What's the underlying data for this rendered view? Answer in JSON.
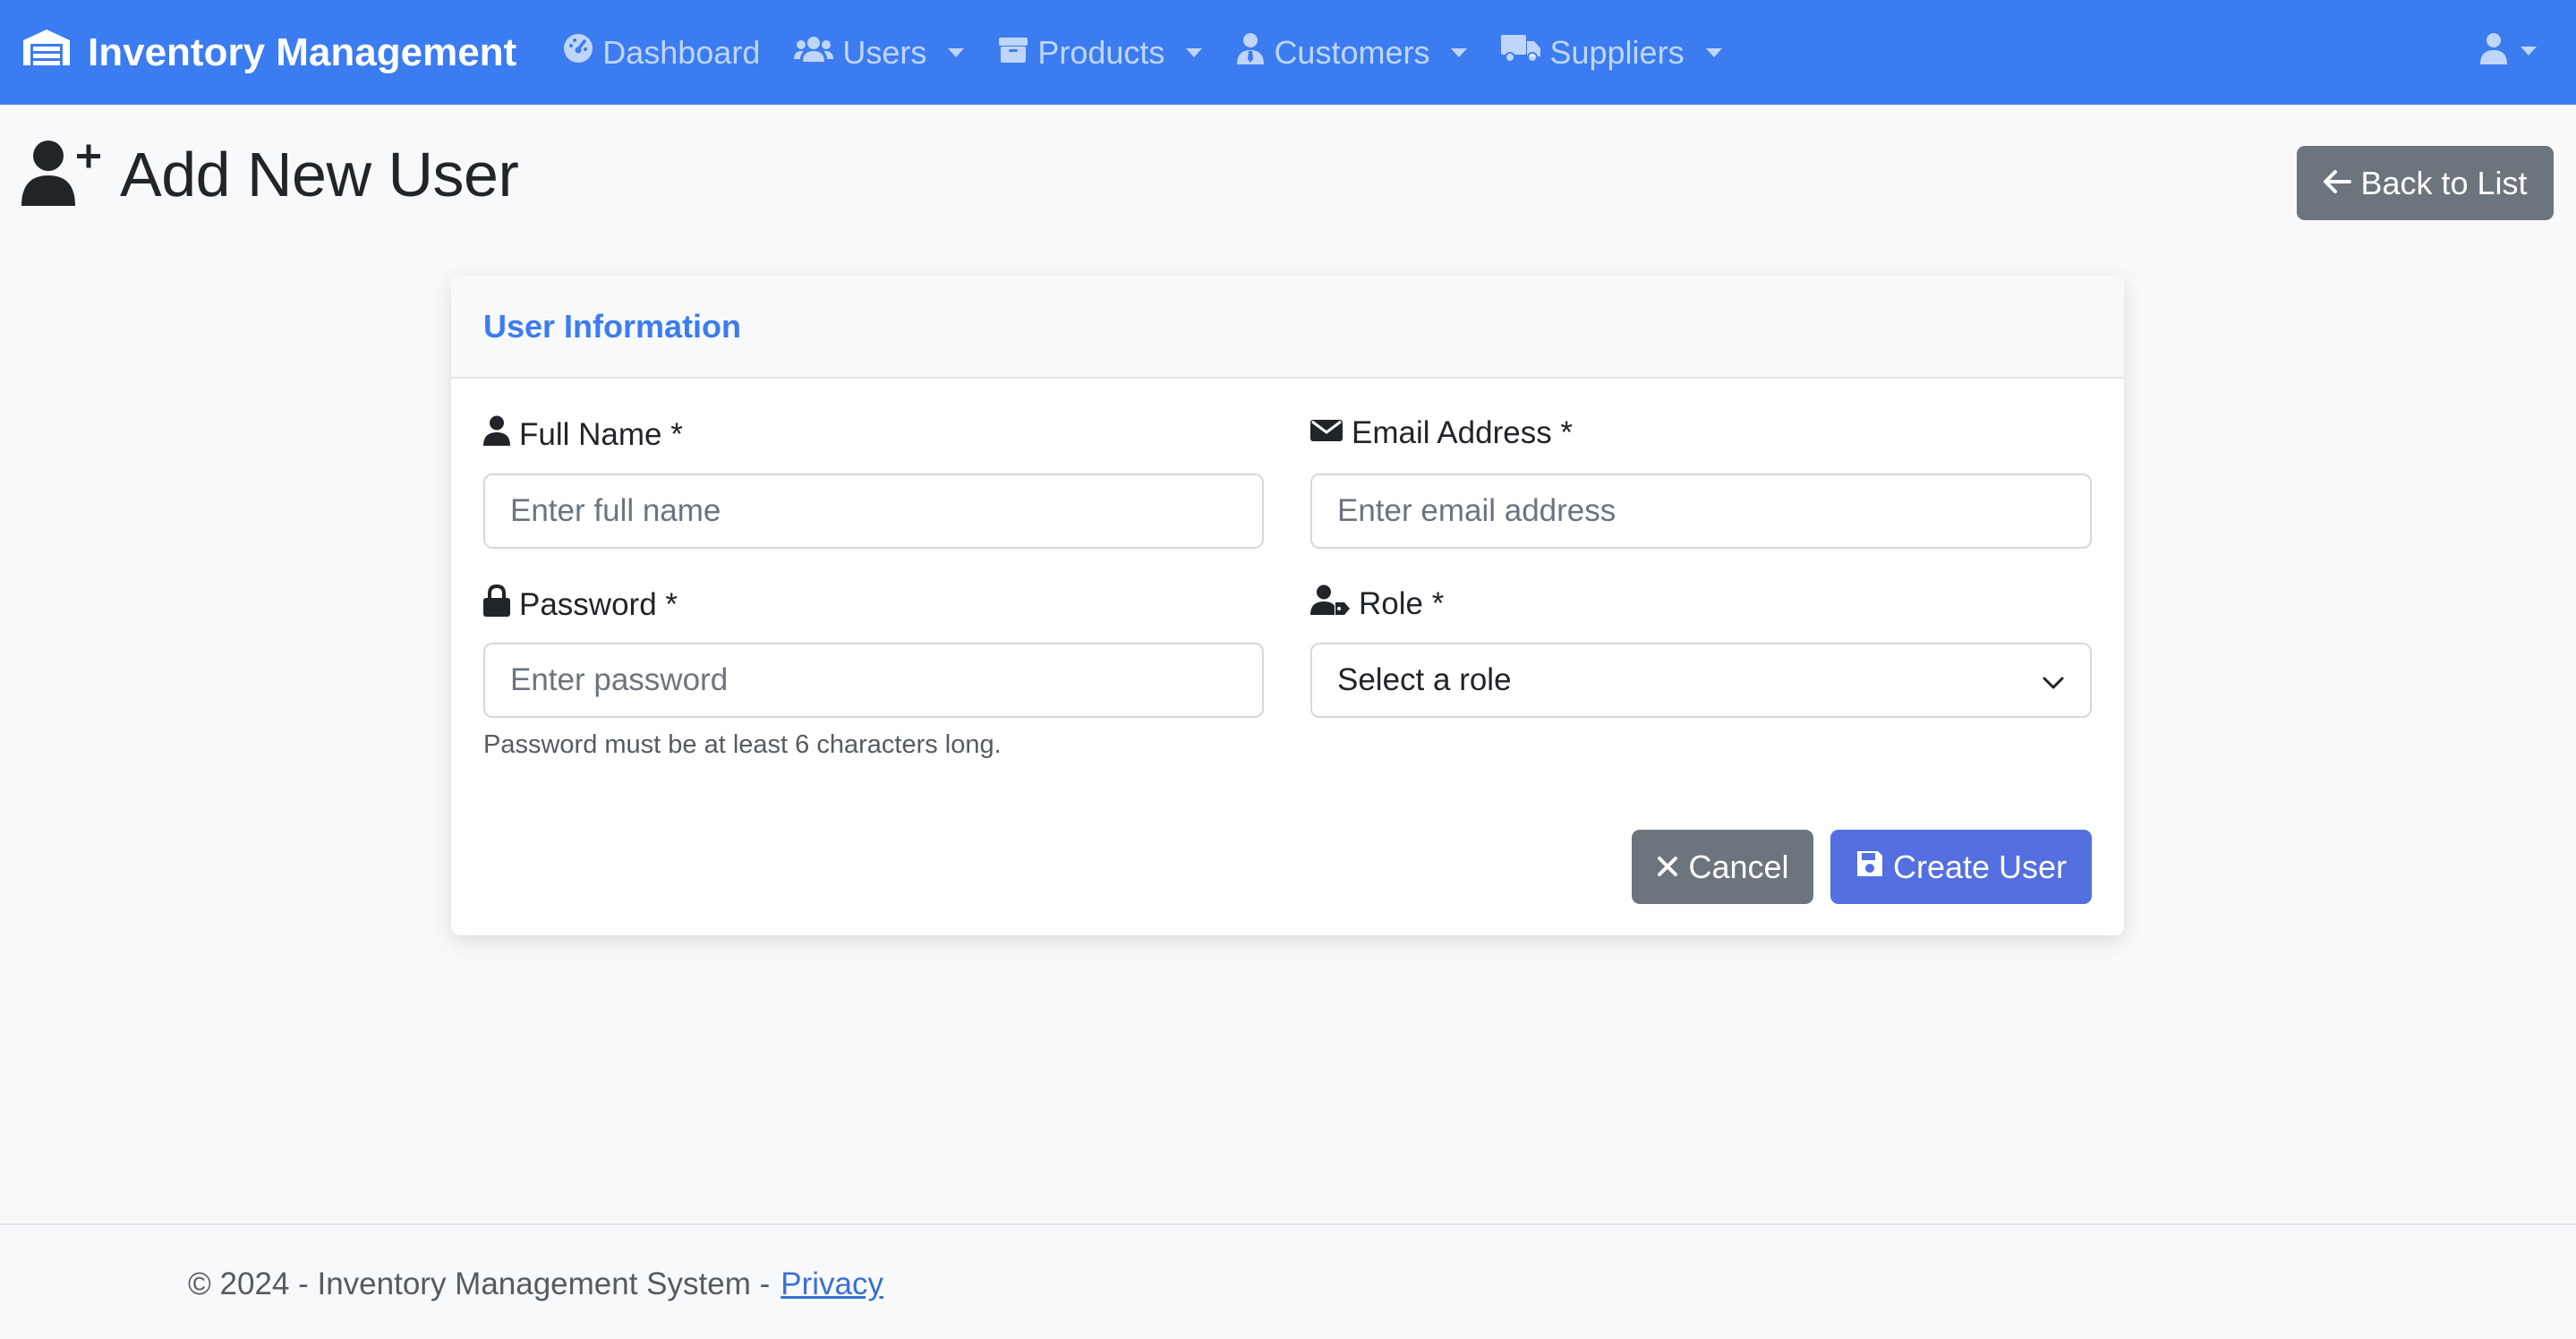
{
  "navbar": {
    "brand": "Inventory Management",
    "items": [
      {
        "label": "Dashboard",
        "icon": "gauge-icon",
        "dropdown": false
      },
      {
        "label": "Users",
        "icon": "users-icon",
        "dropdown": true
      },
      {
        "label": "Products",
        "icon": "box-icon",
        "dropdown": true
      },
      {
        "label": "Customers",
        "icon": "user-tie-icon",
        "dropdown": true
      },
      {
        "label": "Suppliers",
        "icon": "truck-icon",
        "dropdown": true
      }
    ],
    "user_icon": "user-icon"
  },
  "header": {
    "title": "Add New User",
    "icon": "user-plus-icon",
    "back_label": "Back to List"
  },
  "card": {
    "title": "User Information",
    "full_name": {
      "label": "Full Name *",
      "placeholder": "Enter full name",
      "value": ""
    },
    "email": {
      "label": "Email Address *",
      "placeholder": "Enter email address",
      "value": ""
    },
    "password": {
      "label": "Password *",
      "placeholder": "Enter password",
      "help": "Password must be at least 6 characters long.",
      "value": ""
    },
    "role": {
      "label": "Role *",
      "selected": "Select a role"
    },
    "cancel_label": "Cancel",
    "create_label": "Create User"
  },
  "footer": {
    "text": "© 2024 - Inventory Management System -",
    "privacy_link": "Privacy"
  },
  "colors": {
    "navbar": "#3b7cf0",
    "primary_button": "#536fe0",
    "secondary_button": "#6c757d",
    "card_title": "#3b7cf0"
  }
}
